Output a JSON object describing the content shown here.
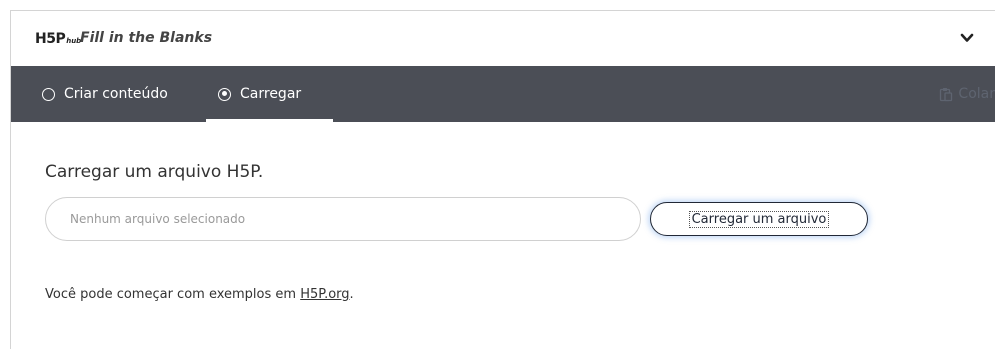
{
  "header": {
    "logo_main": "H5P",
    "logo_sub": "hub",
    "content_type_title": "Fill in the Blanks"
  },
  "tabs": [
    {
      "label": "Criar conteúdo",
      "selected": false
    },
    {
      "label": "Carregar",
      "selected": true
    }
  ],
  "toolbar": {
    "paste_label": "Colar"
  },
  "upload": {
    "title": "Carregar um arquivo H5P.",
    "file_placeholder": "Nenhum arquivo selecionado",
    "button_label": "Carregar um arquivo"
  },
  "examples": {
    "text_before": "Você pode começar com exemplos em ",
    "link_text": "H5P.org",
    "text_after": "."
  },
  "colors": {
    "tab_bar_bg": "#4b4e56",
    "button_border": "#212836"
  }
}
